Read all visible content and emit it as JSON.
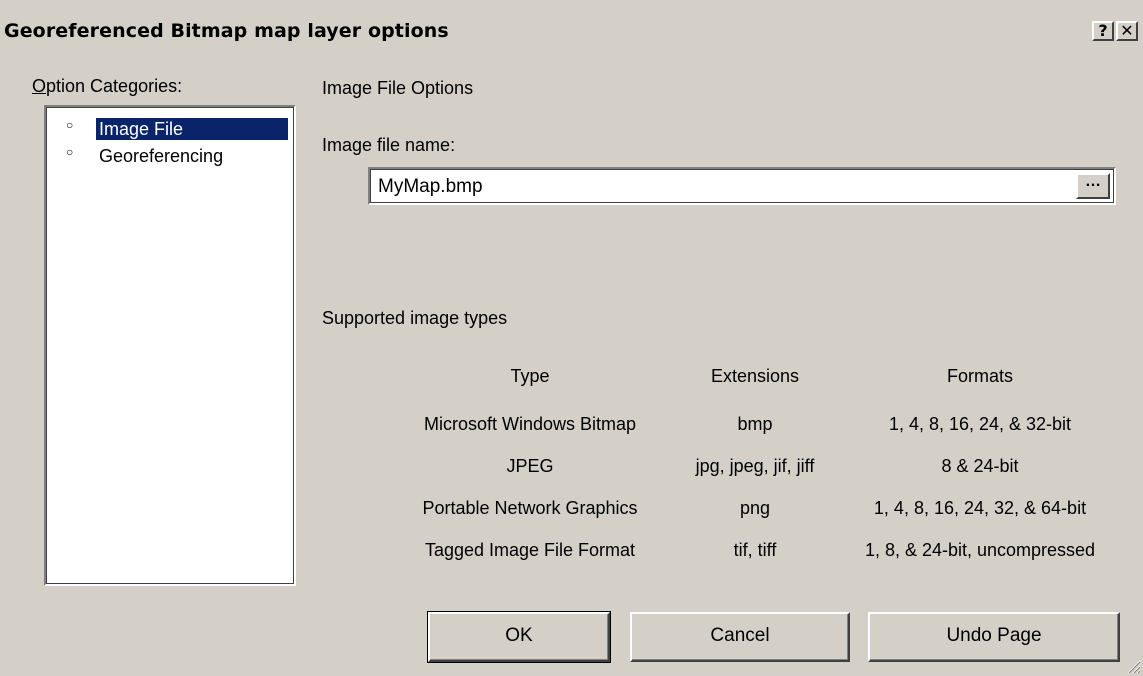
{
  "window": {
    "title": "Georeferenced Bitmap map layer options",
    "help_glyph": "?",
    "close_glyph": "✕"
  },
  "categories": {
    "label_first": "O",
    "label_rest": "ption Categories:",
    "items": [
      {
        "label": "Image File",
        "selected": true
      },
      {
        "label": "Georeferencing",
        "selected": false
      }
    ]
  },
  "main": {
    "section_title": "Image File Options",
    "file_label": "Image file name:",
    "file_value": "MyMap.bmp",
    "browse_label": "…",
    "types_label": "Supported image types",
    "table": {
      "headers": [
        "Type",
        "Extensions",
        "Formats"
      ],
      "rows": [
        [
          "Microsoft Windows Bitmap",
          "bmp",
          "1, 4, 8, 16, 24, & 32-bit"
        ],
        [
          "JPEG",
          "jpg, jpeg, jif, jiff",
          "8 & 24-bit"
        ],
        [
          "Portable Network Graphics",
          "png",
          "1, 4, 8, 16, 24, 32, & 64-bit"
        ],
        [
          "Tagged Image File Format",
          "tif, tiff",
          "1, 8, & 24-bit, uncompressed"
        ]
      ]
    }
  },
  "buttons": {
    "ok": "OK",
    "cancel": "Cancel",
    "undo": "Undo Page"
  }
}
